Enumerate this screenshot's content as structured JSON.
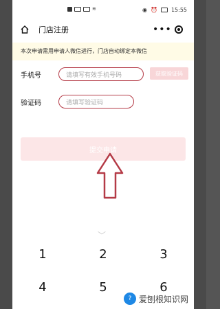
{
  "status_bar": {
    "left_icons": "HD ull ull ≋ 46",
    "time": "15:55"
  },
  "navbar": {
    "title": "门店注册",
    "more_label": "•••"
  },
  "notice": "本次申请需用申请人微信进行，门店自动绑定本微信",
  "form": {
    "phone_label": "手机号",
    "phone_placeholder": "请填写有效手机号码",
    "send_code_label": "获取验证码",
    "code_label": "验证码",
    "code_placeholder": "请填写验证码",
    "submit_label": "提交申请"
  },
  "keypad": {
    "keys": [
      "1",
      "2",
      "3",
      "4",
      "5",
      "6"
    ]
  },
  "watermark": "爱刨根知识网",
  "colors": {
    "annotation_red": "#b43a46",
    "notice_bg": "#fffbe6",
    "submit_bg": "#fce6e7"
  }
}
